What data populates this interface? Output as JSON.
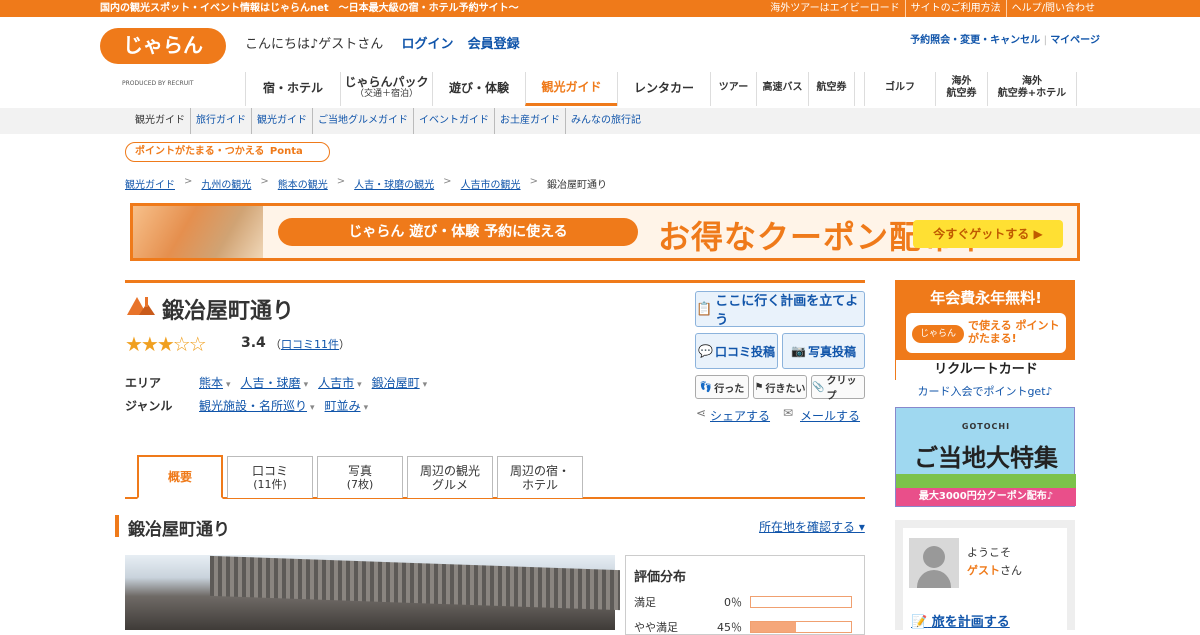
{
  "topbar": {
    "tagline": "国内の観光スポット・イベント情報はじゃらんnet　～日本最大級の宿・ホテル予約サイト～",
    "links": [
      "海外ツアーはエイビーロード",
      "サイトのご利用方法",
      "ヘルプ/問い合わせ"
    ]
  },
  "header": {
    "logo_text": "じゃらん",
    "logo_sub": "PRODUCED BY RECRUIT",
    "greeting": "こんにちは♪ゲストさん",
    "login": "ログイン",
    "register": "会員登録",
    "reservation_link": "予約照会・変更・キャンセル",
    "mypage_link": "マイページ"
  },
  "nav": [
    {
      "label": "宿・ホテル",
      "sub": ""
    },
    {
      "label": "じゃらんパック",
      "sub": "（交通＋宿泊）"
    },
    {
      "label": "遊び・体験",
      "sub": ""
    },
    {
      "label": "観光ガイド",
      "sub": ""
    },
    {
      "label": "レンタカー",
      "sub": ""
    },
    {
      "label": "ツアー",
      "sub": ""
    },
    {
      "label": "高速バス",
      "sub": ""
    },
    {
      "label": "航空券",
      "sub": ""
    },
    {
      "label": "ゴルフ",
      "sub": ""
    },
    {
      "label": "海外",
      "sub": "航空券"
    },
    {
      "label": "海外",
      "sub": "航空券+ホテル"
    }
  ],
  "subnav": [
    "観光ガイド",
    "旅行ガイド",
    "観光ガイド",
    "ご当地グルメガイド",
    "イベントガイド",
    "お土産ガイド",
    "みんなの旅行記"
  ],
  "ponta": "ポイントがたまる・つかえる",
  "ponta_brand": "Ponta",
  "breadcrumb": [
    "観光ガイド",
    "九州の観光",
    "熊本の観光",
    "人吉・球磨の観光",
    "人吉市の観光",
    "鍛冶屋町通り"
  ],
  "banner": {
    "pill": "じゃらん 遊び・体験 予約に使える",
    "headline": "お得なクーポン配布中!",
    "cta": "今すぐゲットする ▶"
  },
  "spot": {
    "title": "鍛冶屋町通り",
    "rating": "3.4",
    "stars": "★★★☆☆",
    "reviews_open": "（",
    "reviews_link": "口コミ11件",
    "reviews_close": "）",
    "area_label": "エリア",
    "areas": [
      "熊本",
      "人吉・球磨",
      "人吉市",
      "鍛冶屋町"
    ],
    "genre_label": "ジャンル",
    "genres": [
      "観光施設・名所巡り",
      "町並み"
    ]
  },
  "actions": {
    "plan": "ここに行く計画を立てよう",
    "review_post": "口コミ投稿",
    "photo_post": "写真投稿",
    "went": "行った",
    "want": "行きたい",
    "clip": "クリップ",
    "share": "シェアする",
    "mail": "メールする"
  },
  "tabs": [
    {
      "label": "概要",
      "sub": ""
    },
    {
      "label": "口コミ",
      "sub": "(11件)"
    },
    {
      "label": "写真",
      "sub": "(7枚)"
    },
    {
      "label": "周辺の観光",
      "sub": "グルメ"
    },
    {
      "label": "周辺の宿・",
      "sub": "ホテル"
    }
  ],
  "section": {
    "title": "鍛冶屋町通り",
    "locate": "所在地を確認する ▾"
  },
  "distribution": {
    "title": "評価分布",
    "rows": [
      {
        "label": "満足",
        "pct": "0％",
        "value": 0
      },
      {
        "label": "やや満足",
        "pct": "45％",
        "value": 45
      }
    ]
  },
  "ads": {
    "card_title": "年会費永年無料!",
    "card_box": "で使える ポイントがたまる!",
    "card_logo": "じゃらん",
    "card_name": "リクルートカード",
    "card_caption": "カード入会でポイントget♪",
    "gotochi_small": "GOTOCHI",
    "gotochi_title": "ご当地大特集",
    "gotochi_strip": "最大3000円分クーポン配布♪"
  },
  "welcome": {
    "hello": "ようこそ",
    "guest": "ゲスト",
    "san": "さん",
    "plan_link": "旅を計画する"
  }
}
